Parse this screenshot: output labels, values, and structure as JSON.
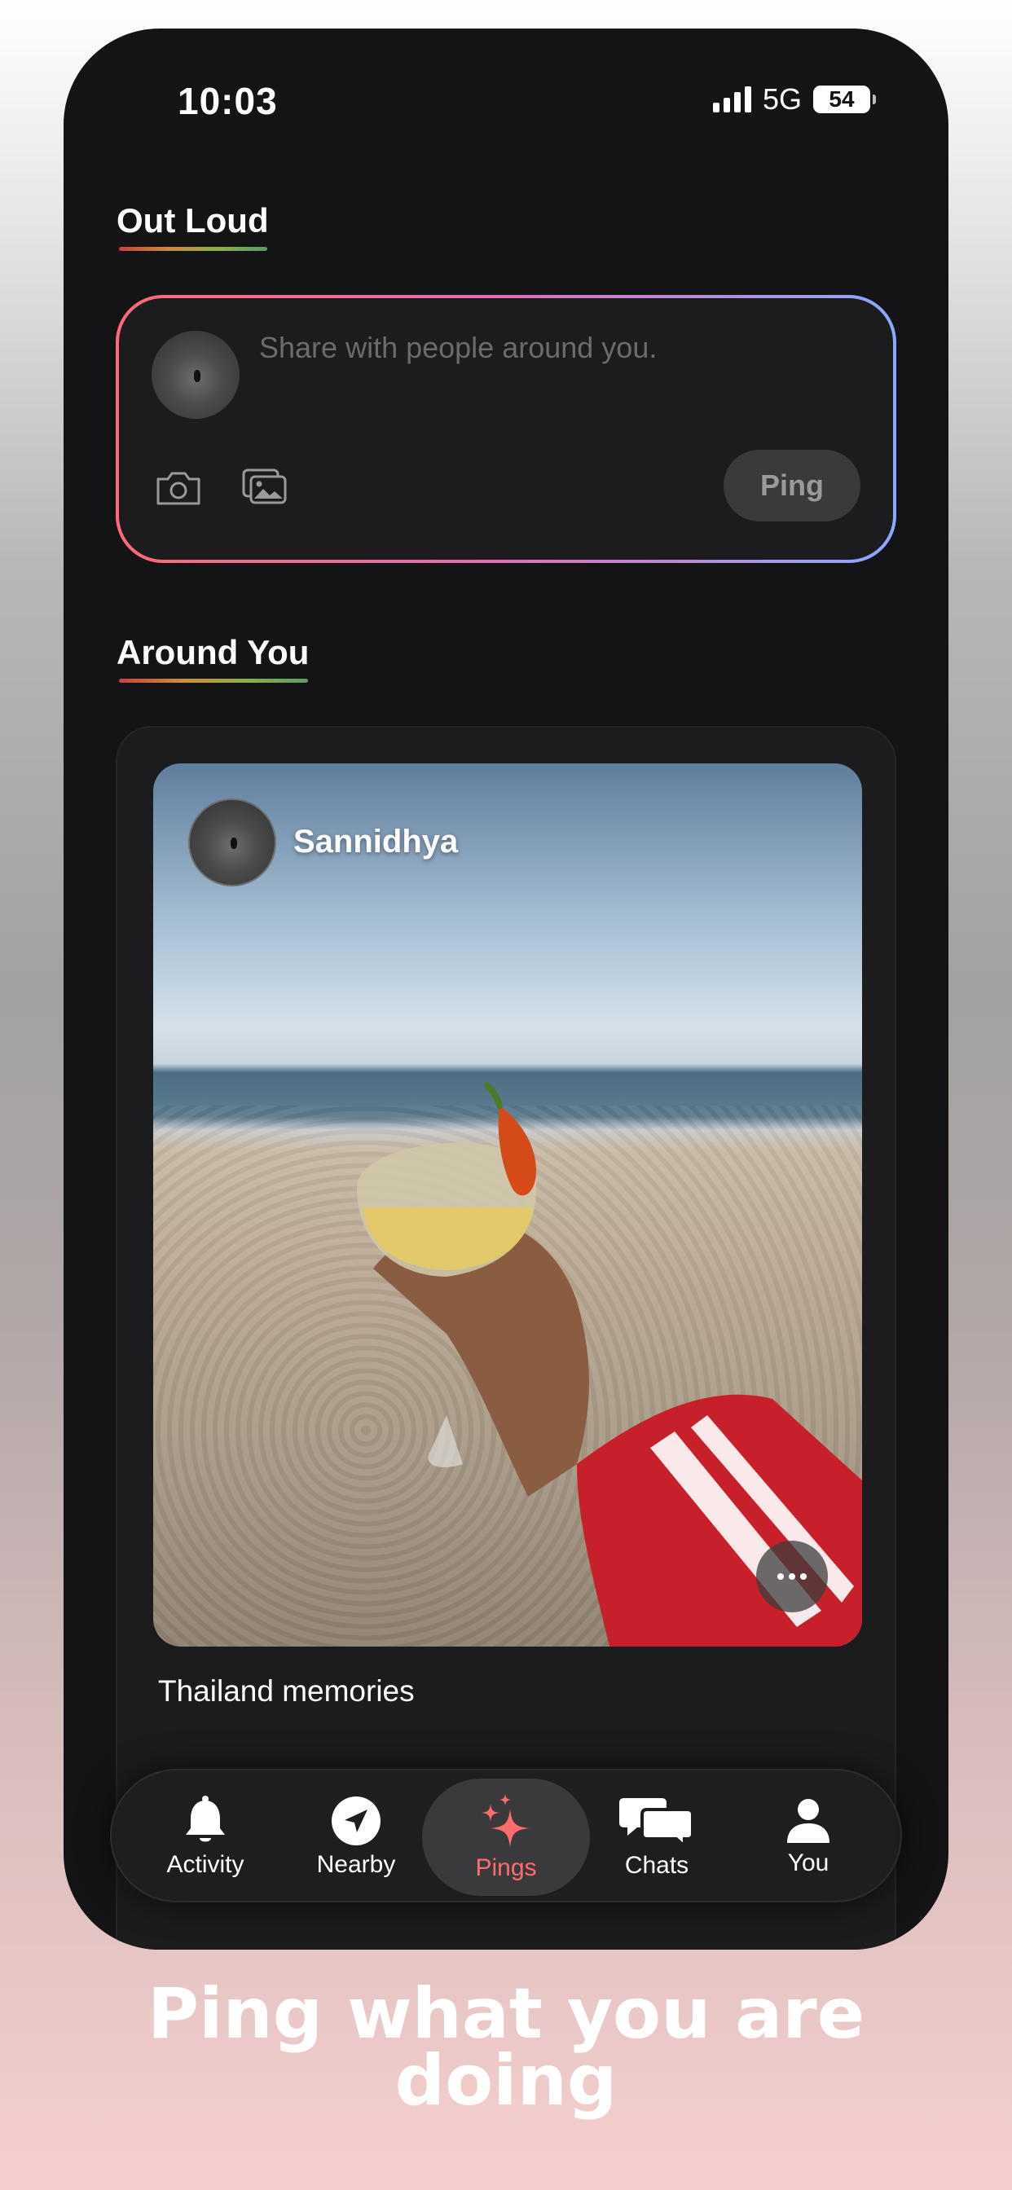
{
  "status_bar": {
    "time": "10:03",
    "network": "5G",
    "battery": "54"
  },
  "out_loud": {
    "title": "Out Loud",
    "placeholder": "Share with people around you.",
    "ping_label": "Ping"
  },
  "around_you": {
    "title": "Around You",
    "post": {
      "user": "Sannidhya",
      "caption": "Thailand memories"
    }
  },
  "tabbar": {
    "items": [
      {
        "label": "Activity",
        "icon": "bell-icon"
      },
      {
        "label": "Nearby",
        "icon": "navigation-arrow-icon"
      },
      {
        "label": "Pings",
        "icon": "sparkle-icon",
        "active": true
      },
      {
        "label": "Chats",
        "icon": "chat-bubbles-icon"
      },
      {
        "label": "You",
        "icon": "person-icon"
      }
    ]
  },
  "tagline": {
    "line1": "Ping what you are",
    "line2": "doing"
  },
  "colors": {
    "accent": "#ff6b6f",
    "background": "#141416"
  }
}
